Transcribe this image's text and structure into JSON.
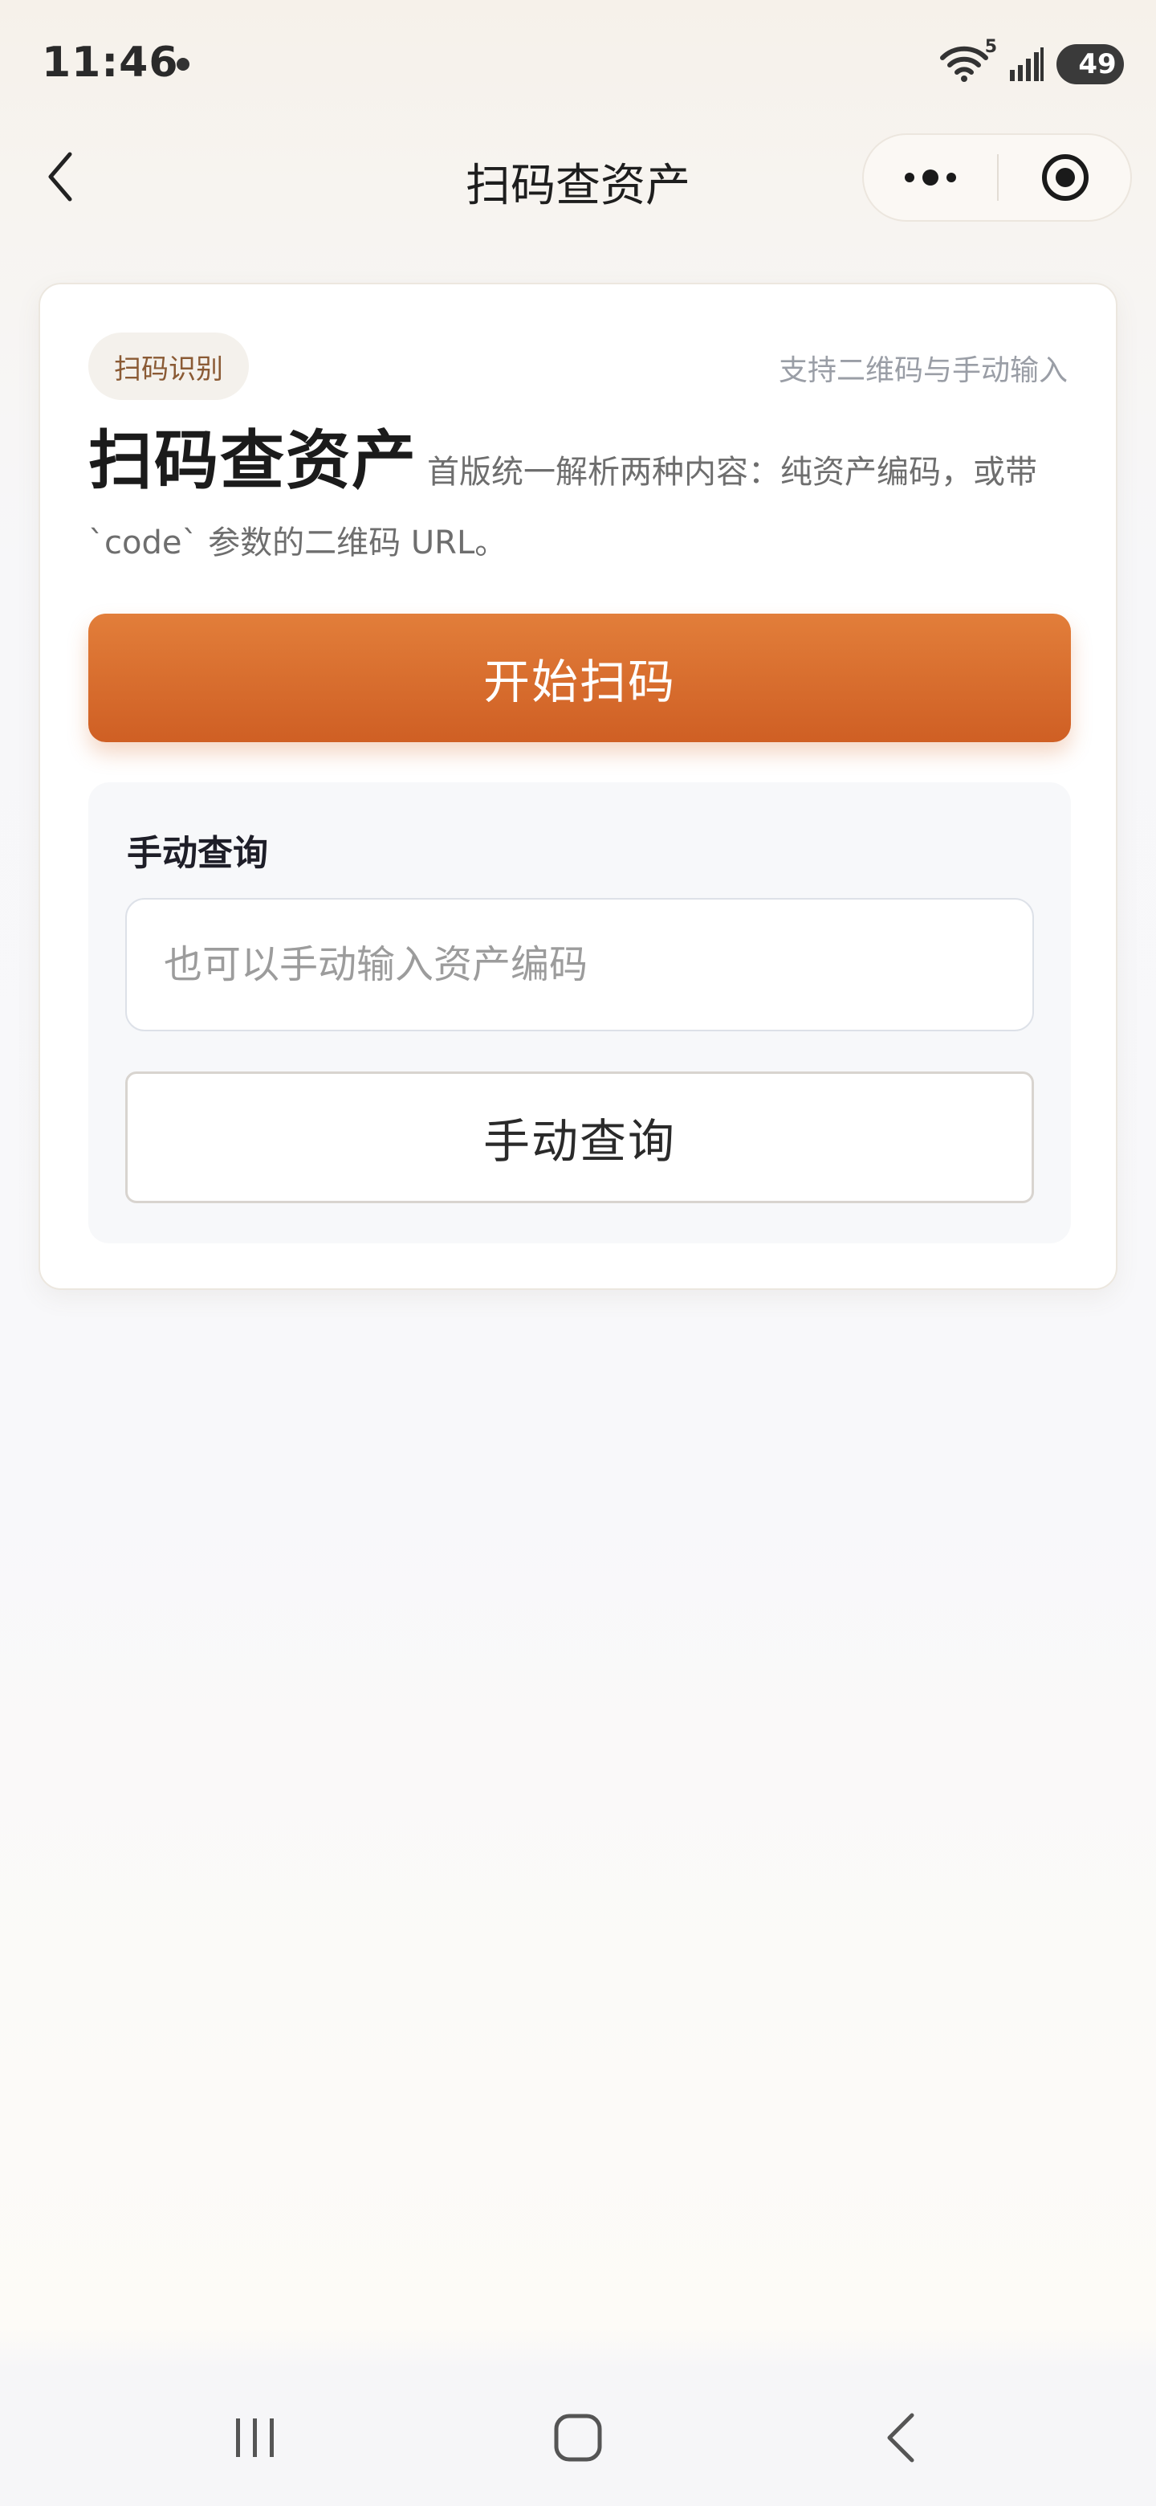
{
  "status_bar": {
    "time": "11:46",
    "battery": "49",
    "wifi_badge": "5"
  },
  "nav": {
    "title": "扫码查资产"
  },
  "card": {
    "tag": "扫码识别",
    "support_text": "支持二维码与手动输入",
    "title": "扫码查资产",
    "description": "首版统一解析两种内容：纯资产编码，或带 `code` 参数的二维码 URL。",
    "scan_button_label": "开始扫码",
    "manual_section": {
      "label": "手动查询",
      "input_value": "",
      "input_placeholder": "也可以手动输入资产编码",
      "query_button_label": "手动查询"
    }
  },
  "colors": {
    "accent": "#d9692c",
    "tag_text": "#8a5a34"
  },
  "icons": {
    "back": "chevron-left-icon",
    "more": "more-dots-icon",
    "close": "target-circle-icon",
    "wifi": "wifi-icon",
    "signal": "signal-icon",
    "sys_recent": "recent-apps-icon",
    "sys_home": "home-icon",
    "sys_back": "back-icon"
  }
}
